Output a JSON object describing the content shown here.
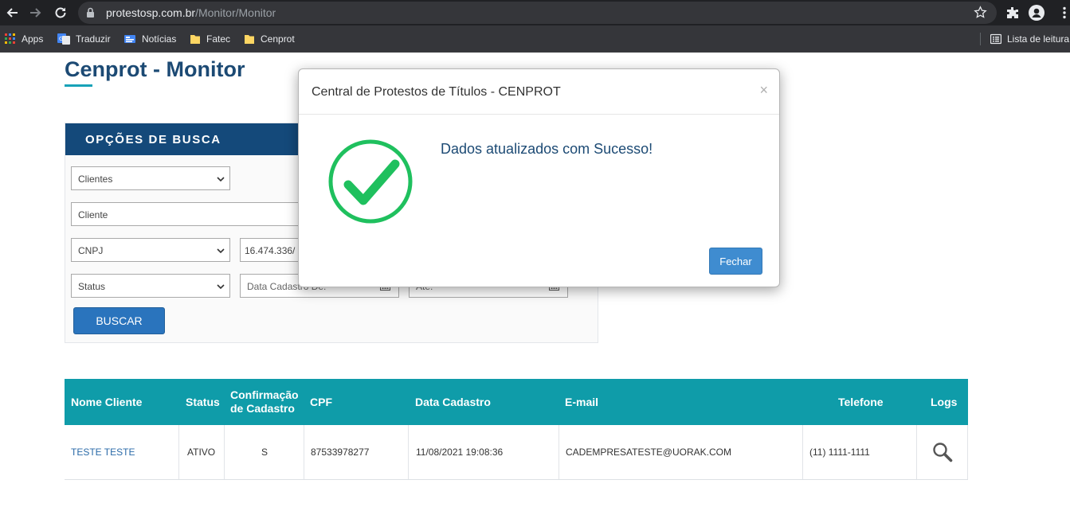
{
  "browser": {
    "url_host": "protestosp.com.br",
    "url_path": "/Monitor/Monitor",
    "bookmarks": [
      {
        "label": "Apps",
        "icon": "apps-grid-icon"
      },
      {
        "label": "Traduzir",
        "icon": "google-translate-icon"
      },
      {
        "label": "Notícias",
        "icon": "news-icon"
      },
      {
        "label": "Fatec",
        "icon": "folder-icon"
      },
      {
        "label": "Cenprot",
        "icon": "folder-icon"
      }
    ],
    "reading_list": "Lista de leitura"
  },
  "page": {
    "title": "Cenprot - Monitor"
  },
  "search_panel": {
    "header": "OPÇÕES DE BUSCA",
    "type_select": "Clientes",
    "cliente_placeholder": "Cliente",
    "doc_select": "CNPJ",
    "doc_value": "16.474.336/",
    "status_select": "Status",
    "date_from_placeholder": "Data Cadastro De:",
    "date_to_placeholder": "Até:",
    "search_button": "BUSCAR"
  },
  "table": {
    "headers": {
      "nome": "Nome Cliente",
      "status": "Status",
      "confirmacao_1": "Confirmação",
      "confirmacao_2": "de Cadastro",
      "cpf": "CPF",
      "data": "Data Cadastro",
      "email": "E-mail",
      "telefone": "Telefone",
      "logs": "Logs"
    },
    "rows": [
      {
        "nome": "TESTE TESTE",
        "status": "ATIVO",
        "confirmacao": "S",
        "cpf": "87533978277",
        "data": "11/08/2021 19:08:36",
        "email": "CADEMPRESATESTE@UORAK.COM",
        "telefone": "(11) 1111-1111"
      }
    ]
  },
  "modal": {
    "title": "Central de Protestos de Títulos - CENPROT",
    "close_glyph": "×",
    "message": "Dados atualizados com Sucesso!",
    "close_button": "Fechar"
  },
  "colors": {
    "brand_navy": "#14497a",
    "table_header_teal": "#0f9ca9",
    "success_green": "#1fc05e",
    "button_blue": "#2a74bd"
  }
}
